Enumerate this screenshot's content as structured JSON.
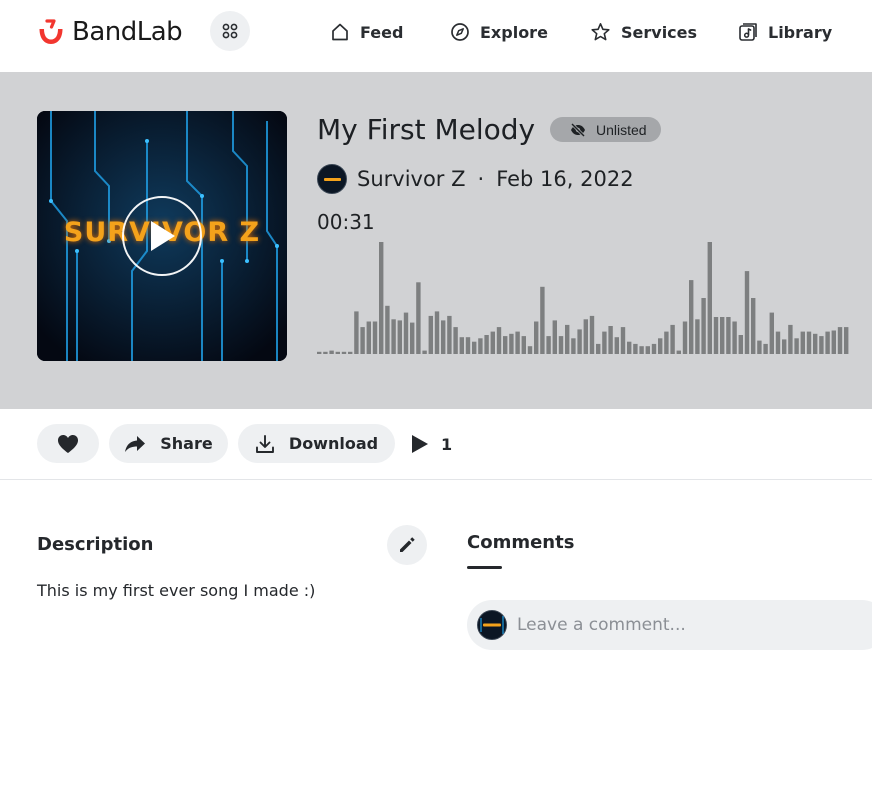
{
  "brand": {
    "name": "BandLab",
    "color": "#f2362f",
    "icon": "bandlab-logo-icon"
  },
  "nav": {
    "apps_icon": "grid-icon",
    "items": [
      {
        "label": "Feed",
        "icon": "home-icon"
      },
      {
        "label": "Explore",
        "icon": "compass-icon"
      },
      {
        "label": "Services",
        "icon": "star-icon"
      },
      {
        "label": "Library",
        "icon": "music-library-icon"
      }
    ]
  },
  "track": {
    "title": "My First Melody",
    "visibility": "Unlisted",
    "visibility_icon": "eye-off-icon",
    "artist": "Survivor Z",
    "separator": "·",
    "date": "Feb 16, 2022",
    "duration": "00:31",
    "cover_text": "SURVIVOR Z",
    "waveform_levels": [
      2,
      2,
      3,
      2,
      2,
      2,
      38,
      24,
      29,
      29,
      100,
      43,
      31,
      30,
      37,
      28,
      64,
      3,
      34,
      38,
      30,
      34,
      24,
      15,
      15,
      11,
      14,
      17,
      20,
      24,
      16,
      18,
      20,
      16,
      7,
      29,
      60,
      16,
      30,
      16,
      26,
      14,
      22,
      31,
      34,
      9,
      20,
      25,
      15,
      24,
      11,
      9,
      7,
      7,
      9,
      14,
      20,
      26,
      3,
      29,
      66,
      31,
      50,
      100,
      33,
      33,
      33,
      29,
      17,
      74,
      50,
      12,
      9,
      37,
      20,
      13,
      26,
      14,
      20,
      20,
      18,
      16,
      20,
      21,
      24,
      24
    ],
    "colors": {
      "hero_bg": "#d1d2d4",
      "waveform": "#7d7f80",
      "cover_accent": "#f4a21b"
    }
  },
  "actions": {
    "like_icon": "heart-icon",
    "share_label": "Share",
    "share_icon": "share-arrow-icon",
    "download_label": "Download",
    "download_icon": "download-icon",
    "plays_icon": "play-icon",
    "play_count": "1"
  },
  "description": {
    "heading": "Description",
    "edit_icon": "pencil-icon",
    "text": "This is my first ever song I made :)"
  },
  "comments": {
    "tab_label": "Comments",
    "placeholder": "Leave a comment..."
  }
}
